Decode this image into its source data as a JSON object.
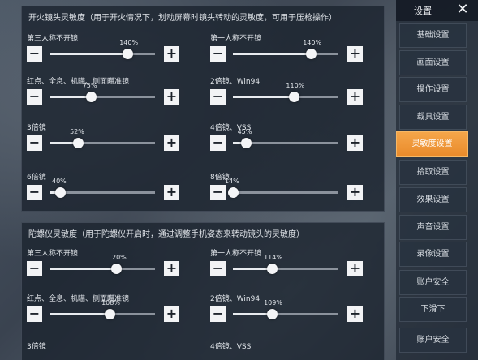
{
  "sensitivity_fire": {
    "title": "开火镜头灵敏度（用于开火情况下，划动屏幕时镜头转动的灵敏度，可用于压枪操作）",
    "items": [
      {
        "label": "第三人称不开镜",
        "value": "140%",
        "percent": 0.74
      },
      {
        "label": "第一人称不开镜",
        "value": "140%",
        "percent": 0.74
      },
      {
        "label": "红点、全息、机瞄、侧面瞄准镜",
        "value": "75%",
        "percent": 0.39
      },
      {
        "label": "2倍镜、Win94",
        "value": "110%",
        "percent": 0.58
      },
      {
        "label": "3倍镜",
        "value": "52%",
        "percent": 0.27
      },
      {
        "label": "4倍镜、VSS",
        "value": "45%",
        "percent": 0.12
      },
      {
        "label": "6倍镜",
        "value": "40%",
        "percent": 0.1
      },
      {
        "label": "8倍镜",
        "value": "14%",
        "percent": 0.0
      }
    ]
  },
  "sensitivity_gyro": {
    "title": "陀螺仪灵敏度（用于陀螺仪开启时，通过调整手机姿态来转动镜头的灵敏度）",
    "items": [
      {
        "label": "第三人称不开镜",
        "value": "120%",
        "percent": 0.63
      },
      {
        "label": "第一人称不开镜",
        "value": "114%",
        "percent": 0.37
      },
      {
        "label": "红点、全息、机瞄、侧面瞄准镜",
        "value": "108%",
        "percent": 0.57
      },
      {
        "label": "2倍镜、Win94",
        "value": "109%",
        "percent": 0.37
      }
    ],
    "partial_labels": [
      "3倍镜",
      "4倍镜、VSS"
    ]
  },
  "sidebar": {
    "title": "设置",
    "close_icon": "close-icon",
    "items": [
      {
        "label": "基础设置",
        "active": false
      },
      {
        "label": "画面设置",
        "active": false
      },
      {
        "label": "操作设置",
        "active": false
      },
      {
        "label": "载具设置",
        "active": false
      },
      {
        "label": "灵敏度设置",
        "active": true
      },
      {
        "label": "拾取设置",
        "active": false
      },
      {
        "label": "效果设置",
        "active": false
      },
      {
        "label": "声音设置",
        "active": false
      },
      {
        "label": "录像设置",
        "active": false
      },
      {
        "label": "账户安全",
        "active": false
      },
      {
        "label": "下滑下",
        "active": false
      },
      {
        "label": "账户安全",
        "active": false
      }
    ]
  },
  "colors": {
    "accent": "#f0962f",
    "panel_bg": "#1c2430"
  }
}
